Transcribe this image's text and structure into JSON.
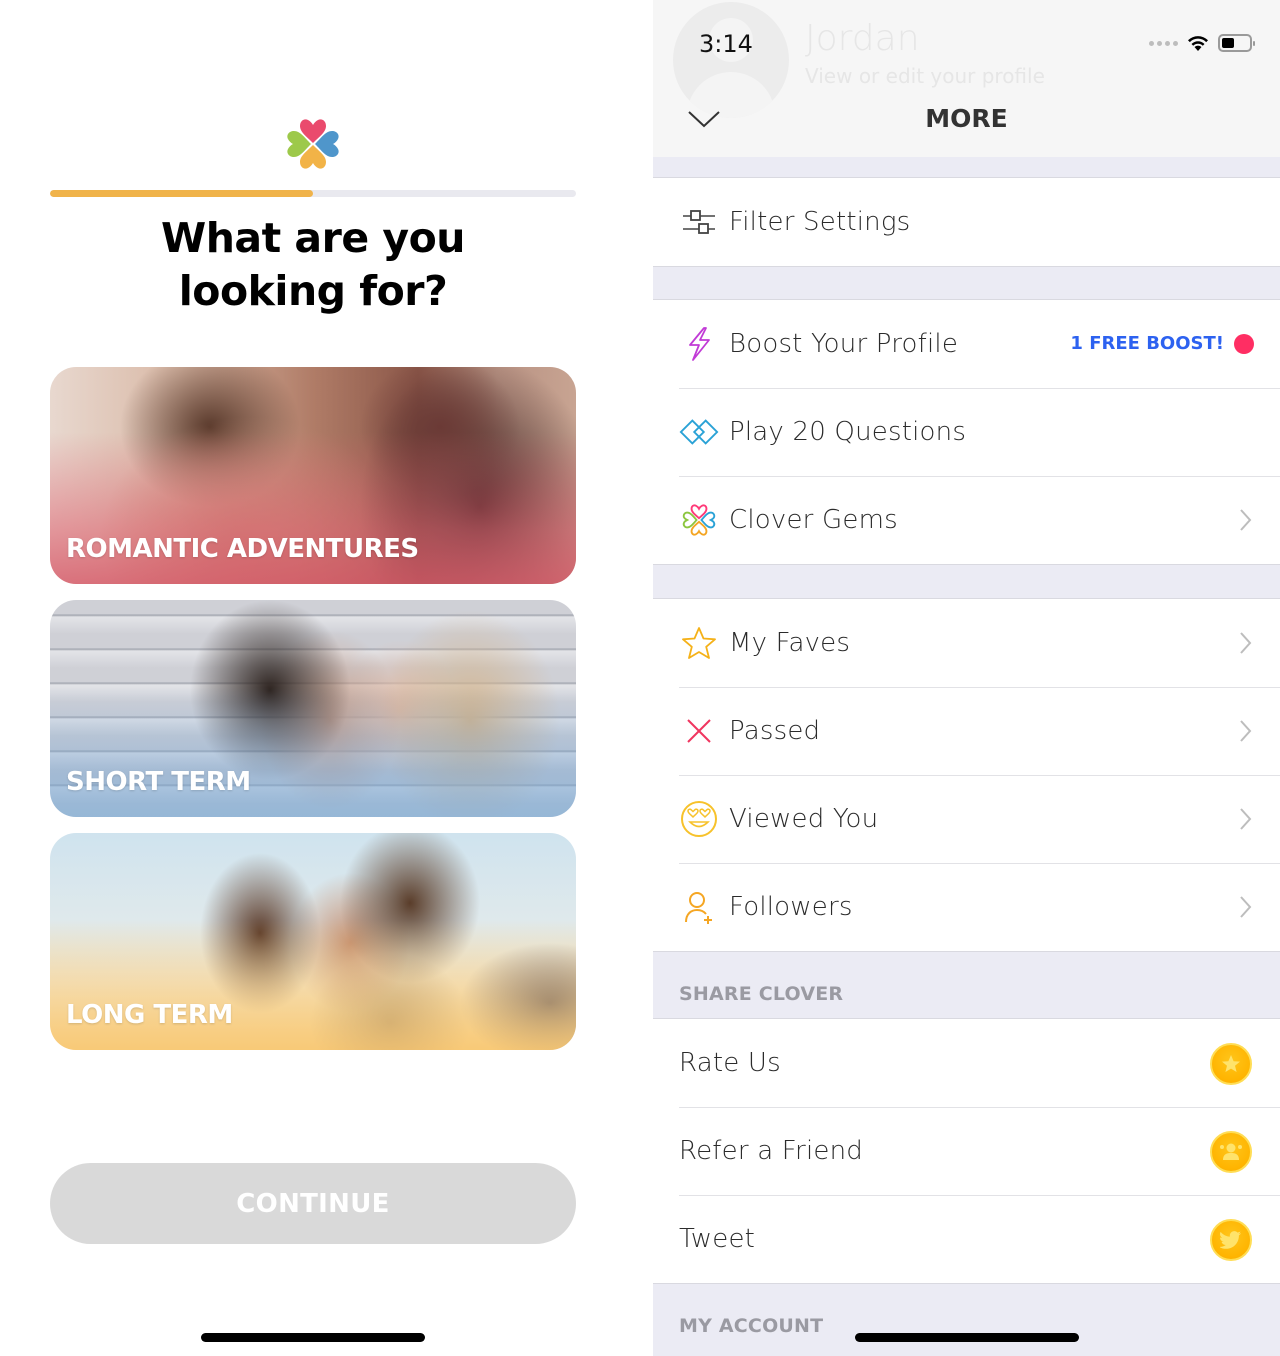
{
  "onboarding": {
    "title_line1": "What are you",
    "title_line2": "looking for?",
    "progress_percent": 50,
    "progress_color": "#f0b34a",
    "options": [
      {
        "label": "ROMANTIC ADVENTURES",
        "theme": "pink"
      },
      {
        "label": "SHORT TERM",
        "theme": "blue"
      },
      {
        "label": "LONG TERM",
        "theme": "amber"
      }
    ],
    "continue_label": "CONTINUE",
    "continue_enabled": false
  },
  "status_bar": {
    "time": "3:14",
    "battery_percent": 45,
    "icons": [
      "signal-dots-icon",
      "wifi-icon",
      "battery-icon"
    ]
  },
  "more": {
    "profile_name": "Jordan",
    "profile_subtitle": "View or edit your profile",
    "title": "MORE",
    "group1": [
      {
        "label": "Filter Settings",
        "icon": "sliders-icon"
      }
    ],
    "group2": [
      {
        "label": "Boost Your Profile",
        "icon": "lightning-icon",
        "badge": "1 FREE BOOST!",
        "badge_color": "#2d62f0",
        "dot_color": "#ff2e63"
      },
      {
        "label": "Play 20 Questions",
        "icon": "double-diamond-icon"
      },
      {
        "label": "Clover Gems",
        "icon": "clover-outline-icon",
        "chevron": true
      }
    ],
    "group3": [
      {
        "label": "My Faves",
        "icon": "star-outline-icon",
        "chevron": true
      },
      {
        "label": "Passed",
        "icon": "x-icon",
        "chevron": true
      },
      {
        "label": "Viewed You",
        "icon": "heart-eyes-icon",
        "chevron": true
      },
      {
        "label": "Followers",
        "icon": "user-plus-icon",
        "chevron": true
      }
    ],
    "share_section_label": "SHARE CLOVER",
    "share": [
      {
        "label": "Rate Us",
        "icon": "star-coin-icon"
      },
      {
        "label": "Refer a Friend",
        "icon": "friends-coin-icon"
      },
      {
        "label": "Tweet",
        "icon": "twitter-coin-icon"
      }
    ],
    "account_section_label": "MY ACCOUNT"
  }
}
